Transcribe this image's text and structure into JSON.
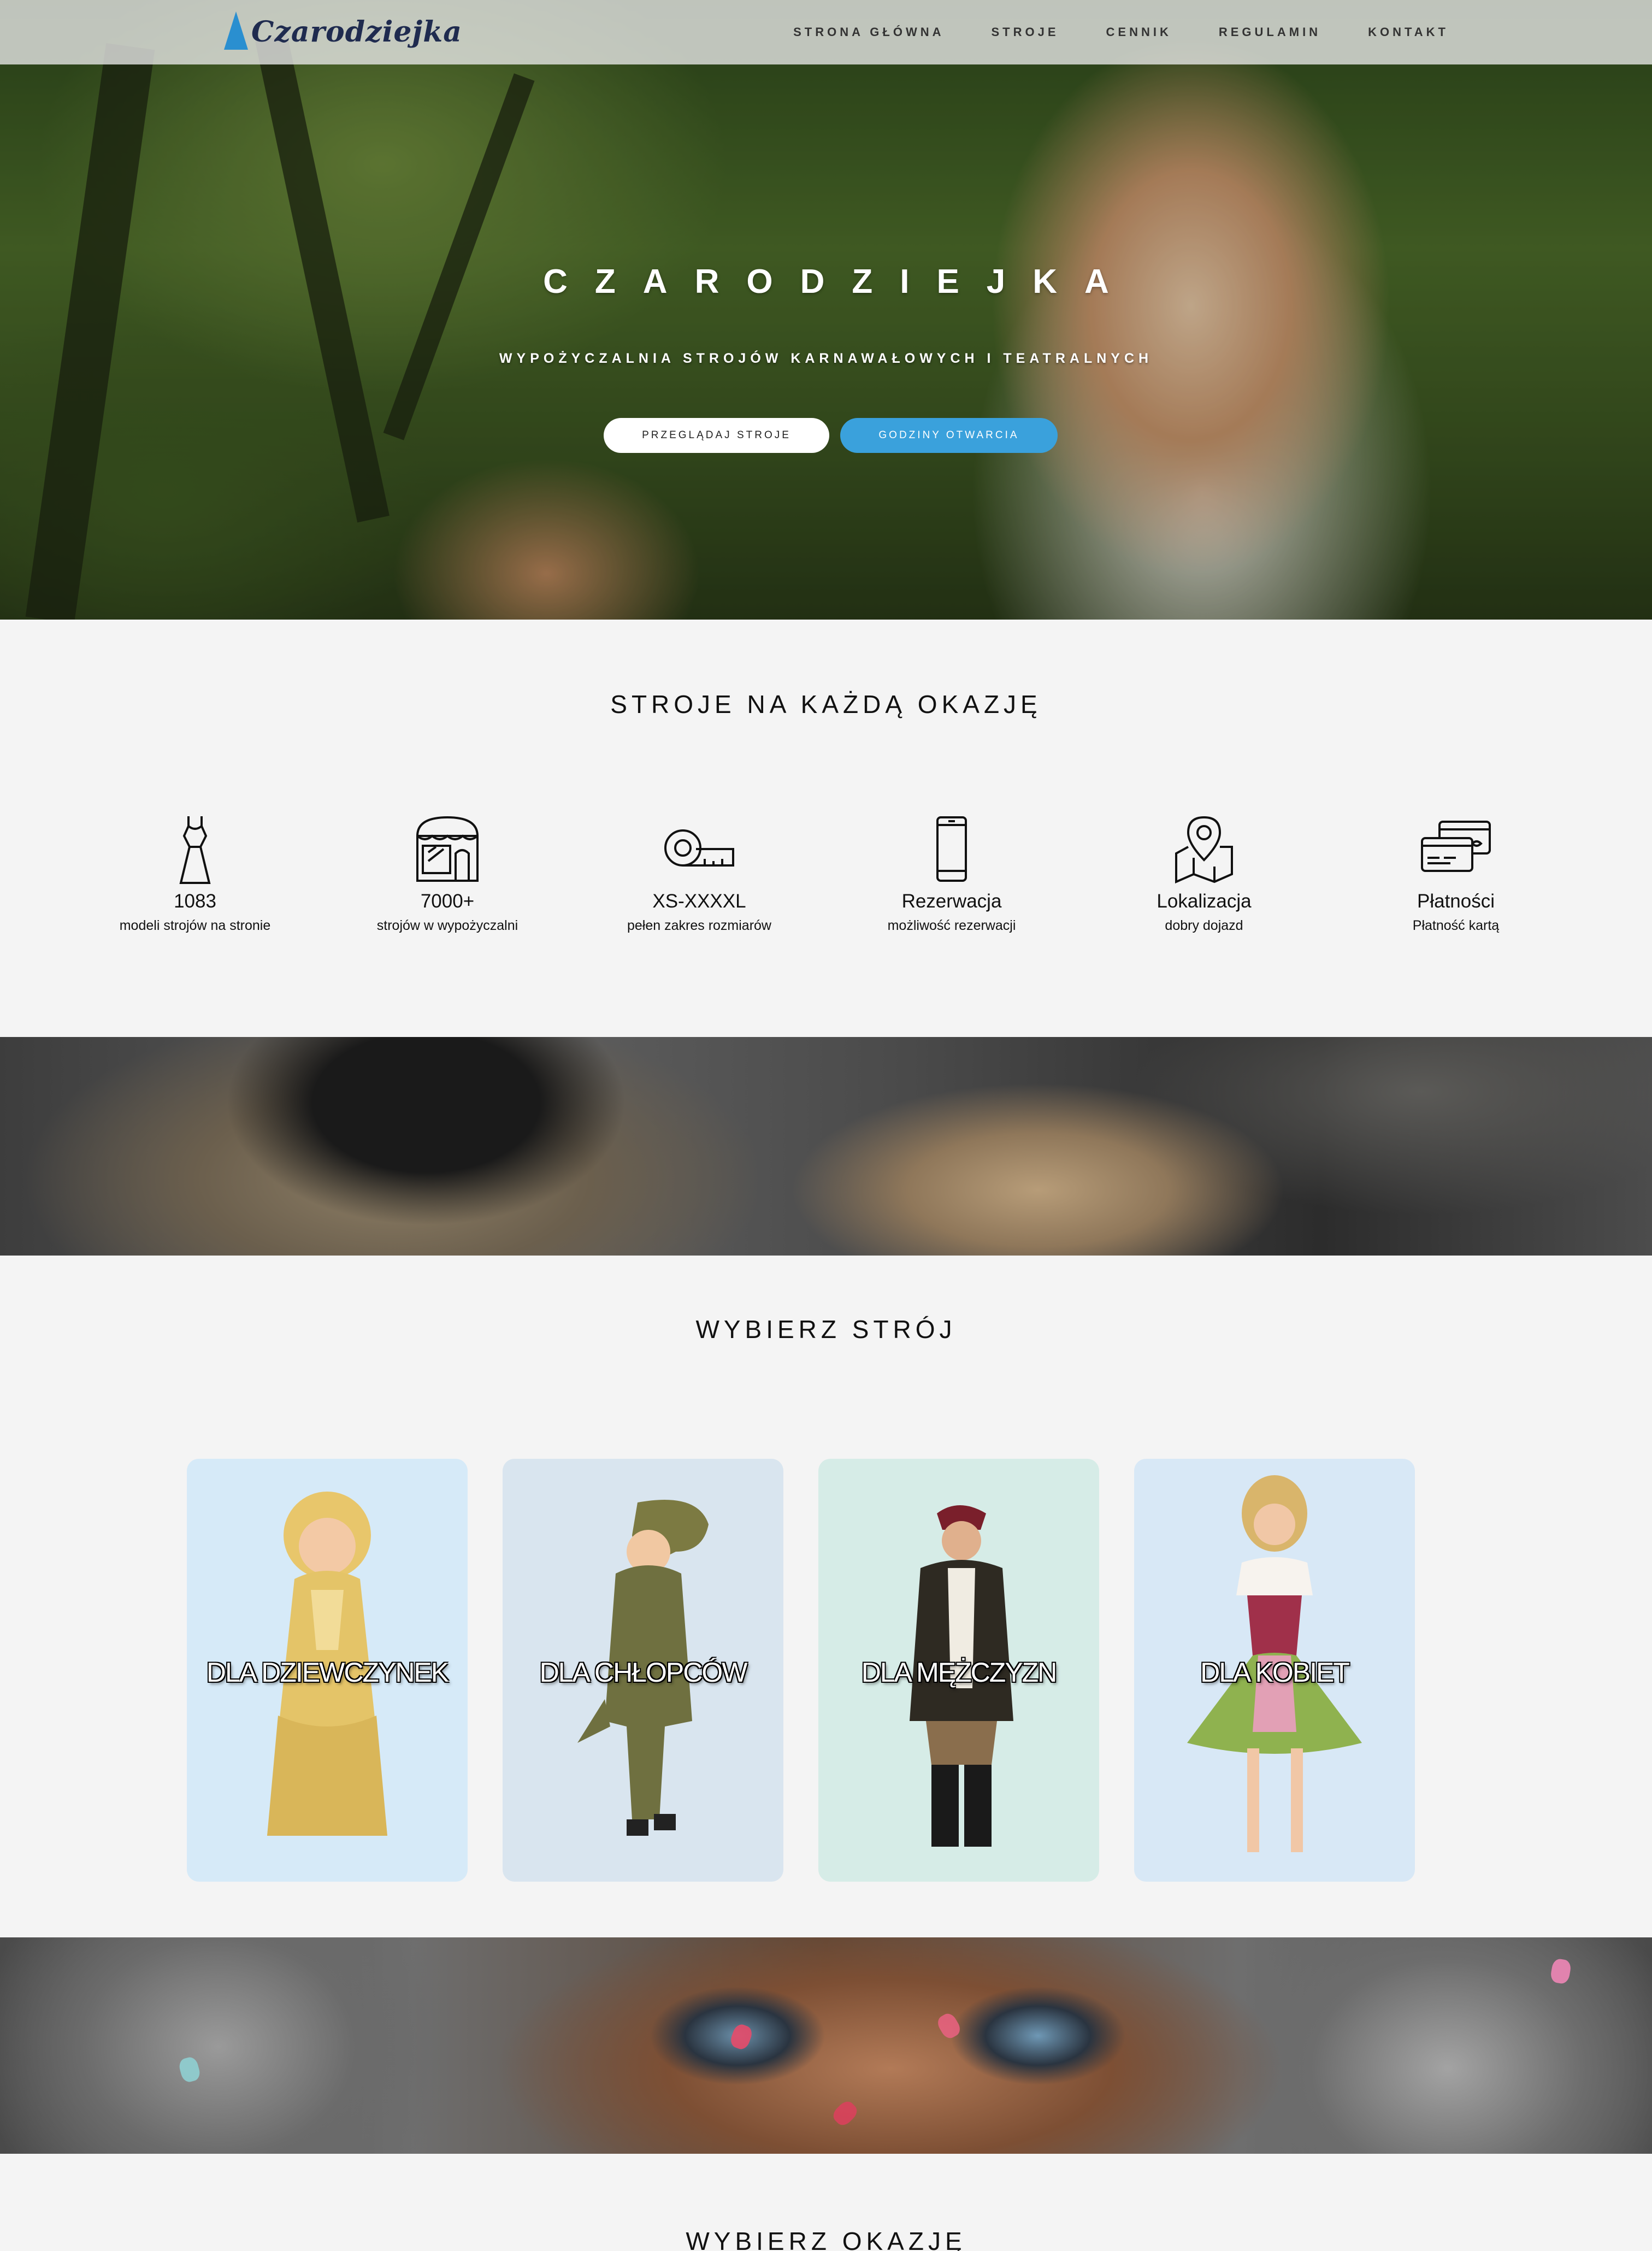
{
  "brand": {
    "logo_text": "Czarodziejka"
  },
  "nav": {
    "items": [
      "STRONA GŁÓWNA",
      "STROJE",
      "CENNIK",
      "REGULAMIN",
      "KONTAKT"
    ]
  },
  "hero": {
    "title": "CZARODZIEJKA",
    "subtitle": "WYPOŻYCZALNIA STROJÓW KARNAWAŁOWYCH I TEATRALNYCH",
    "primary_button": "PRZEGLĄDAJ STROJE",
    "secondary_button": "GODZINY OTWARCIA",
    "accent_color": "#3aa1dc"
  },
  "features_section": {
    "title": "STROJE NA KAŻDĄ OKAZJĘ",
    "items": [
      {
        "icon": "dress-icon",
        "title": "1083",
        "subtitle": "modeli strojów na stronie"
      },
      {
        "icon": "shop-icon",
        "title": "7000+",
        "subtitle": "strojów w wypożyczalni"
      },
      {
        "icon": "tape-measure-icon",
        "title": "XS-XXXXL",
        "subtitle": "pełen zakres rozmiarów"
      },
      {
        "icon": "smartphone-icon",
        "title": "Rezerwacja",
        "subtitle": "możliwość rezerwacji"
      },
      {
        "icon": "map-pin-icon",
        "title": "Lokalizacja",
        "subtitle": "dobry dojazd"
      },
      {
        "icon": "credit-card-icon",
        "title": "Płatności",
        "subtitle": "Płatność kartą"
      }
    ]
  },
  "costumes_section": {
    "title": "WYBIERZ STRÓJ",
    "categories": [
      {
        "label": "DLA DZIEWCZYNEK",
        "bg": "#d6eaf8"
      },
      {
        "label": "DLA CHŁOPCÓW",
        "bg": "#d9e5ef"
      },
      {
        "label": "DLA MĘŻCZYZN",
        "bg": "#d6ece7"
      },
      {
        "label": "DLA KOBIET",
        "bg": "#d8e8f6"
      }
    ]
  },
  "occasions_section": {
    "title": "WYBIERZ OKAZJĘ"
  }
}
